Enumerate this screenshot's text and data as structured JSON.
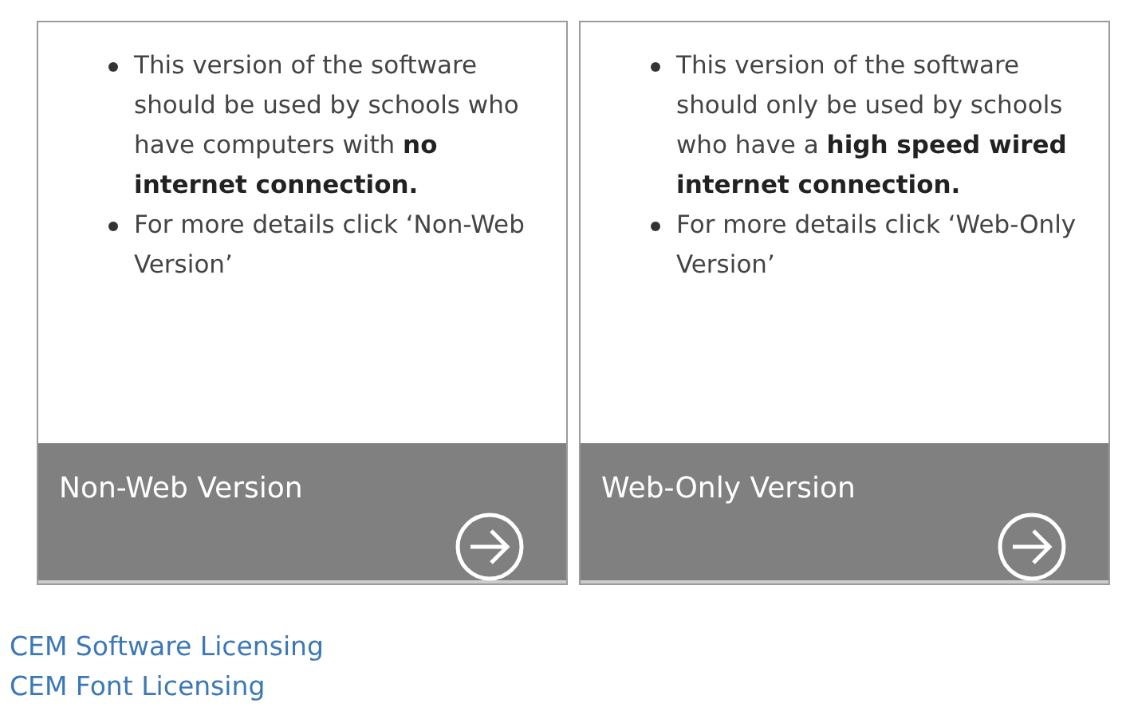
{
  "cards": [
    {
      "bullets": [
        "This version of the software should be used by schools who have computers with **no internet connection.**",
        "For more details click ‘Non-Web Version’"
      ],
      "footer": {
        "label": "Non-Web Version"
      }
    },
    {
      "bullets": [
        "This version of the software should only be used by schools who have a **high speed wired internet connection.**",
        "For more details click ‘Web-Only Version’"
      ],
      "footer": {
        "label": "Web-Only Version"
      }
    }
  ],
  "links": [
    "CEM Software Licensing",
    "CEM Font Licensing"
  ]
}
